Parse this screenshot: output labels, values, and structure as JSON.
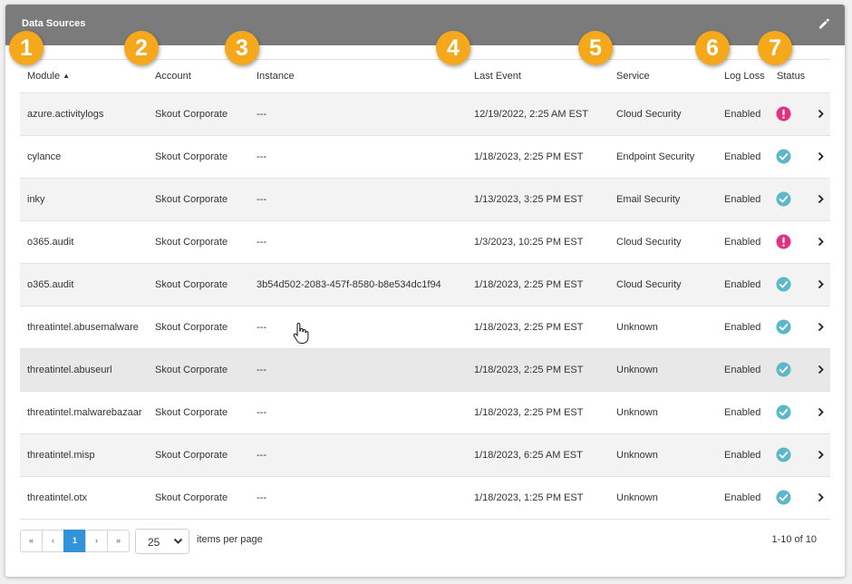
{
  "panel": {
    "title": "Data Sources"
  },
  "badges": [
    "1",
    "2",
    "3",
    "4",
    "5",
    "6",
    "7"
  ],
  "table": {
    "columns": {
      "module": "Module",
      "account": "Account",
      "instance": "Instance",
      "last_event": "Last Event",
      "service": "Service",
      "log_loss": "Log Loss",
      "status": "Status"
    },
    "sort": {
      "column": "module",
      "direction": "ascending"
    },
    "rows": [
      {
        "module": "azure.activitylogs",
        "account": "Skout Corporate",
        "instance": "---",
        "last_event": "12/19/2022, 2:25 AM EST",
        "service": "Cloud Security",
        "log_loss": "Enabled",
        "status": "error"
      },
      {
        "module": "cylance",
        "account": "Skout Corporate",
        "instance": "---",
        "last_event": "1/18/2023, 2:25 PM EST",
        "service": "Endpoint Security",
        "log_loss": "Enabled",
        "status": "ok"
      },
      {
        "module": "inky",
        "account": "Skout Corporate",
        "instance": "---",
        "last_event": "1/13/2023, 3:25 PM EST",
        "service": "Email Security",
        "log_loss": "Enabled",
        "status": "ok"
      },
      {
        "module": "o365.audit",
        "account": "Skout Corporate",
        "instance": "---",
        "last_event": "1/3/2023, 10:25 PM EST",
        "service": "Cloud Security",
        "log_loss": "Enabled",
        "status": "error"
      },
      {
        "module": "o365.audit",
        "account": "Skout Corporate",
        "instance": "3b54d502-2083-457f-8580-b8e534dc1f94",
        "last_event": "1/18/2023, 2:25 PM EST",
        "service": "Cloud Security",
        "log_loss": "Enabled",
        "status": "ok"
      },
      {
        "module": "threatintel.abusemalware",
        "account": "Skout Corporate",
        "instance": "---",
        "last_event": "1/18/2023, 2:25 PM EST",
        "service": "Unknown",
        "log_loss": "Enabled",
        "status": "ok"
      },
      {
        "module": "threatintel.abuseurl",
        "account": "Skout Corporate",
        "instance": "---",
        "last_event": "1/18/2023, 2:25 PM EST",
        "service": "Unknown",
        "log_loss": "Enabled",
        "status": "ok"
      },
      {
        "module": "threatintel.malwarebazaar",
        "account": "Skout Corporate",
        "instance": "---",
        "last_event": "1/18/2023, 2:25 PM EST",
        "service": "Unknown",
        "log_loss": "Enabled",
        "status": "ok"
      },
      {
        "module": "threatintel.misp",
        "account": "Skout Corporate",
        "instance": "---",
        "last_event": "1/18/2023, 6:25 AM EST",
        "service": "Unknown",
        "log_loss": "Enabled",
        "status": "ok"
      },
      {
        "module": "threatintel.otx",
        "account": "Skout Corporate",
        "instance": "---",
        "last_event": "1/18/2023, 1:25 PM EST",
        "service": "Unknown",
        "log_loss": "Enabled",
        "status": "ok"
      }
    ]
  },
  "pagination": {
    "first": "«",
    "prev": "‹",
    "current_page": "1",
    "next": "›",
    "last": "»",
    "page_size": "25",
    "items_per_page_label": "items per page",
    "range": "1-10 of 10"
  },
  "colors": {
    "header_bg": "#7b7b7b",
    "badge": "#f5a81c",
    "status_ok": "#5bb8c9",
    "status_error": "#e2317e",
    "active_page": "#3393d8"
  },
  "icons": {
    "edit": "pencil-icon",
    "sort": "sort-ascending-icon",
    "status_ok": "check-circle-icon",
    "status_error": "exclamation-circle-icon",
    "row_action": "chevron-right-icon",
    "dropdown": "chevron-down-icon",
    "cursor": "hand-pointer-icon"
  }
}
